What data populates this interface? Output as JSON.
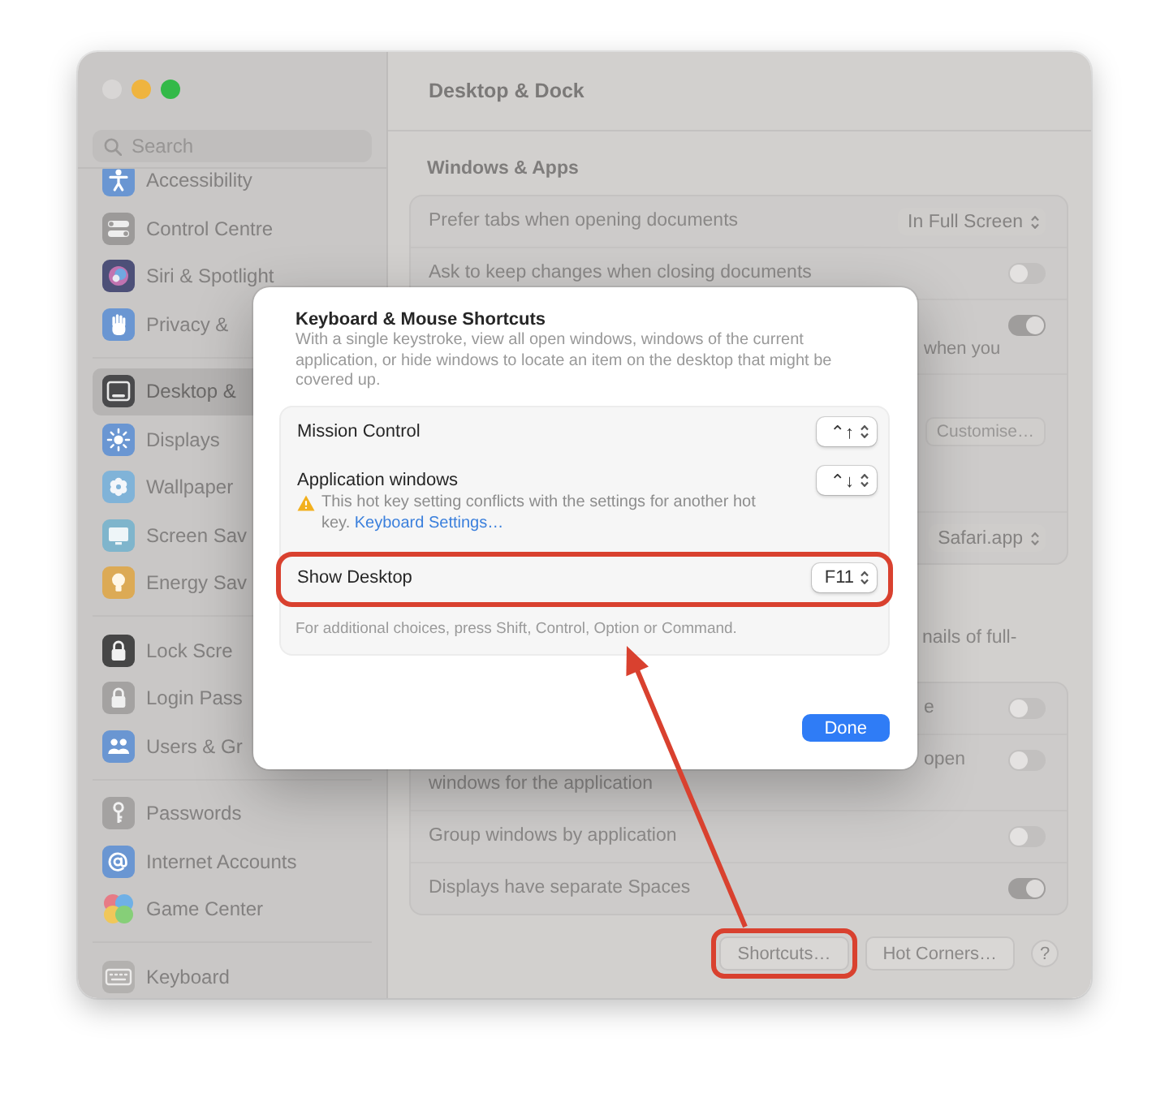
{
  "sidebar": {
    "search": {
      "placeholder": "Search"
    },
    "groups": [
      {
        "items": [
          {
            "label": "Accessibility",
            "selected": false
          },
          {
            "label": "Control Centre",
            "selected": false
          },
          {
            "label": "Siri & Spotlight",
            "selected": false
          },
          {
            "label": "Privacy &",
            "selected": false
          }
        ]
      },
      {
        "items": [
          {
            "label": "Desktop &",
            "selected": true
          },
          {
            "label": "Displays",
            "selected": false
          },
          {
            "label": "Wallpaper",
            "selected": false
          },
          {
            "label": "Screen Sav",
            "selected": false
          },
          {
            "label": "Energy Sav",
            "selected": false
          }
        ]
      },
      {
        "items": [
          {
            "label": "Lock Scre",
            "selected": false
          },
          {
            "label": "Login Pass",
            "selected": false
          },
          {
            "label": "Users & Gr",
            "selected": false
          }
        ]
      },
      {
        "items": [
          {
            "label": "Passwords",
            "selected": false
          },
          {
            "label": "Internet Accounts",
            "selected": false
          },
          {
            "label": "Game Center",
            "selected": false
          }
        ]
      },
      {
        "items": [
          {
            "label": "Keyboard",
            "selected": false
          }
        ]
      }
    ]
  },
  "pane": {
    "title": "Desktop & Dock",
    "sections": [
      {
        "heading": "Windows & Apps",
        "rows": [
          {
            "kind": "popup",
            "label": "Prefer tabs when opening documents",
            "value": "In Full Screen"
          },
          {
            "kind": "toggle",
            "label": "Ask to keep changes when closing documents",
            "on": false
          },
          {
            "kind": "toggle",
            "note_tail": "when you",
            "on": true
          },
          {
            "kind": "button",
            "button": "Customise…"
          },
          {
            "kind": "popup",
            "value": "Safari.app"
          }
        ]
      },
      {
        "description_tail": "nails of full-",
        "rows": [
          {
            "kind": "toggle",
            "label_tail": "e",
            "on": false
          },
          {
            "kind": "toggle",
            "label_tail": "open",
            "label_line2": "windows for the application",
            "on": false
          },
          {
            "kind": "toggle",
            "label": "Group windows by application",
            "on": false
          },
          {
            "kind": "toggle",
            "label": "Displays have separate Spaces",
            "on": true
          }
        ]
      }
    ],
    "buttons": [
      {
        "kind": "push",
        "label": "Shortcuts…",
        "highlighted": true
      },
      {
        "kind": "push",
        "label": "Hot Corners…",
        "highlighted": false
      },
      {
        "kind": "help",
        "label": "?",
        "highlighted": false
      }
    ]
  },
  "dialog": {
    "title": "Keyboard & Mouse Shortcuts",
    "description": "With a single keystroke, view all open windows, windows of the current application, or hide windows to locate an item on the desktop that might be covered up.",
    "shortcuts": [
      {
        "label": "Mission Control",
        "key": "⌃↑",
        "highlighted": false
      },
      {
        "label": "Application windows",
        "key": "⌃↓",
        "warning": "This hot key setting conflicts with the settings for another hot key.",
        "link": "Keyboard Settings…",
        "highlighted": false
      },
      {
        "label": "Show Desktop",
        "key": "F11",
        "highlighted": true
      }
    ],
    "hint": "For additional choices, press Shift, Control, Option or Command.",
    "button": "Done"
  }
}
